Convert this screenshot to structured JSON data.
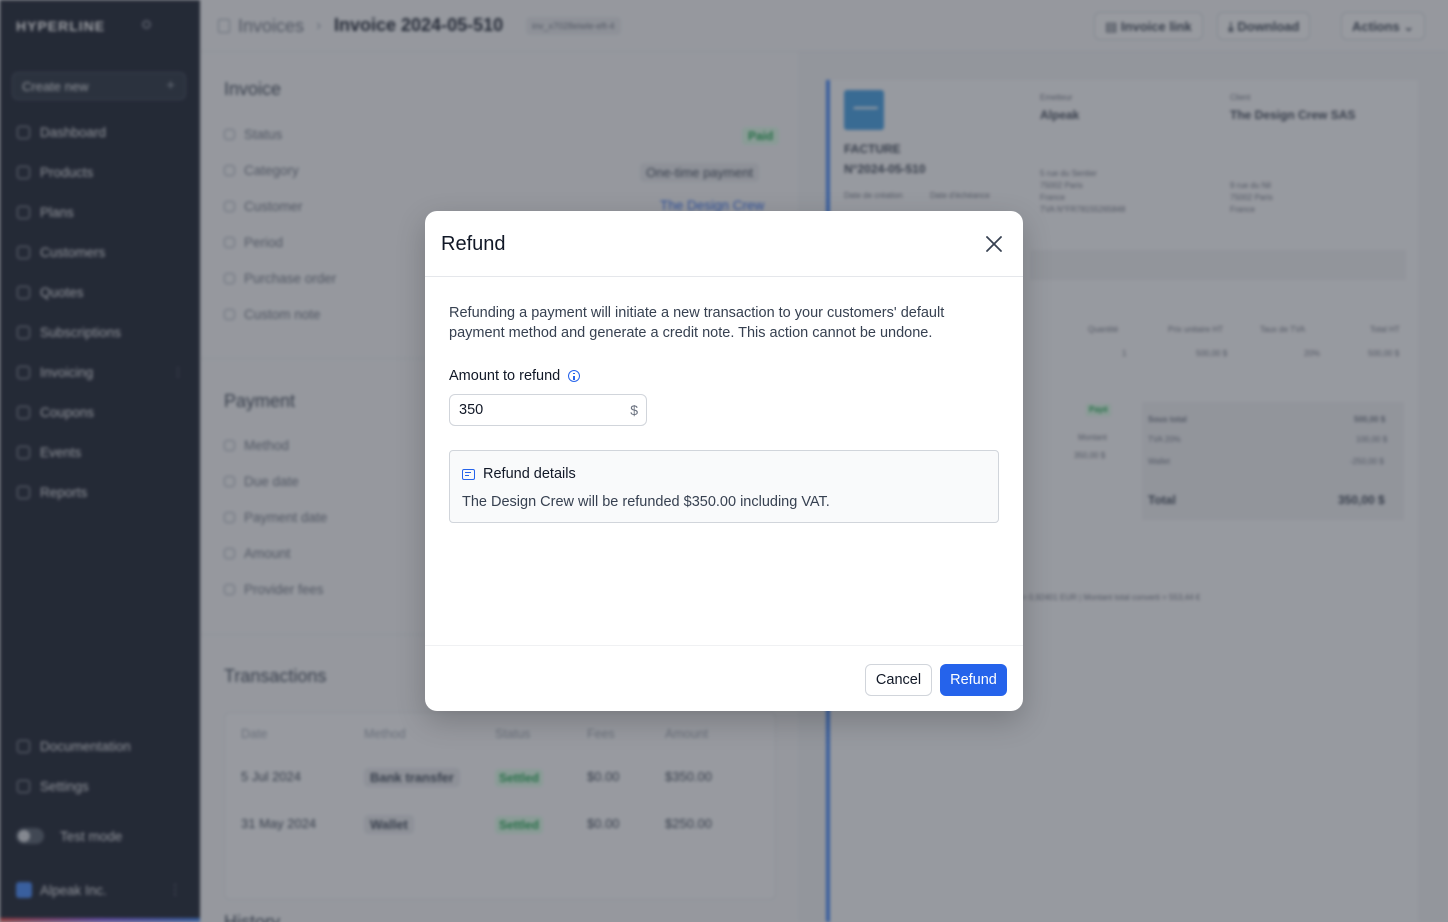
{
  "sidebar": {
    "brand": "HYPERLINE",
    "create_new": "Create new",
    "items": [
      {
        "label": "Dashboard"
      },
      {
        "label": "Products"
      },
      {
        "label": "Plans"
      },
      {
        "label": "Customers"
      },
      {
        "label": "Quotes"
      },
      {
        "label": "Subscriptions"
      },
      {
        "label": "Invoicing"
      },
      {
        "label": "Coupons"
      },
      {
        "label": "Events"
      },
      {
        "label": "Reports"
      }
    ],
    "bottom_items": [
      {
        "label": "Documentation"
      },
      {
        "label": "Settings"
      }
    ],
    "test_mode": "Test mode",
    "org_name": "Alpeak Inc."
  },
  "topbar": {
    "breadcrumb_parent": "Invoices",
    "breadcrumb_current": "Invoice 2024-05-510",
    "invoice_id": "inv_x7028eiwle-eft-4",
    "invoice_link": "Invoice link",
    "download": "Download",
    "actions": "Actions"
  },
  "invoice_section": {
    "title": "Invoice",
    "fields": {
      "status": "Status",
      "category": "Category",
      "customer": "Customer",
      "period": "Period",
      "purchase_order": "Purchase order",
      "custom_note": "Custom note"
    },
    "status_value": "Paid",
    "category_value": "One-time payment",
    "customer_value": "The Design Crew"
  },
  "payment_section": {
    "title": "Payment",
    "fields": {
      "method": "Method",
      "due_date": "Due date",
      "payment_date": "Payment date",
      "amount": "Amount",
      "provider_fees": "Provider fees"
    }
  },
  "transactions": {
    "title": "Transactions",
    "columns": [
      "Date",
      "Method",
      "Status",
      "Fees",
      "Amount"
    ],
    "rows": [
      {
        "date": "5 Jul 2024",
        "method": "Bank transfer",
        "status": "Settled",
        "fees": "$0.00",
        "amount": "$350.00"
      },
      {
        "date": "31 May 2024",
        "method": "Wallet",
        "status": "Settled",
        "fees": "$0.00",
        "amount": "$250.00"
      }
    ]
  },
  "history_title": "History",
  "preview": {
    "doc_type": "FACTURE",
    "doc_number": "N°2024-05-510",
    "created_label": "Date de création",
    "due_label": "Date d'échéance",
    "emitter_label": "Emetteur",
    "emitter_name": "Alpeak",
    "emitter_address": [
      "5 rue du Sentier",
      "75002 Paris",
      "France",
      "TVA N°FR78155265848"
    ],
    "client_label": "Client",
    "client_name": "The Design Crew SAS",
    "client_address": [
      "9 rue du Nil",
      "75002 Paris",
      "France"
    ],
    "columns": [
      "Quantité",
      "Prix unitaire HT",
      "Taux de TVA",
      "Total HT"
    ],
    "line": {
      "qty": "1",
      "unit": "500,00 $",
      "vat": "20%",
      "total": "500,00 $"
    },
    "paid_badge": "Payé",
    "payment_cols": [
      "Montant"
    ],
    "payment_amount": "350,00 $",
    "totals": [
      {
        "label": "Sous total",
        "value": "500,00 $"
      },
      {
        "label": "TVA 20%",
        "value": "100,00 $"
      },
      {
        "label": "Wallet",
        "value": "-250,00 $"
      }
    ],
    "total_label": "Total",
    "total_value": "350,00 $",
    "footnote": "= 0,92401 EUR | Montant total converti = 553,44 €"
  },
  "modal": {
    "title": "Refund",
    "description": "Refunding a payment will initiate a new transaction to your customers' default payment method and generate a credit note. This action cannot be undone.",
    "amount_label": "Amount to refund",
    "amount_value": "350",
    "currency": "$",
    "details_title": "Refund details",
    "details_text": "The Design Crew will be refunded $350.00 including VAT.",
    "cancel": "Cancel",
    "confirm": "Refund",
    "accent": "#2563eb"
  }
}
